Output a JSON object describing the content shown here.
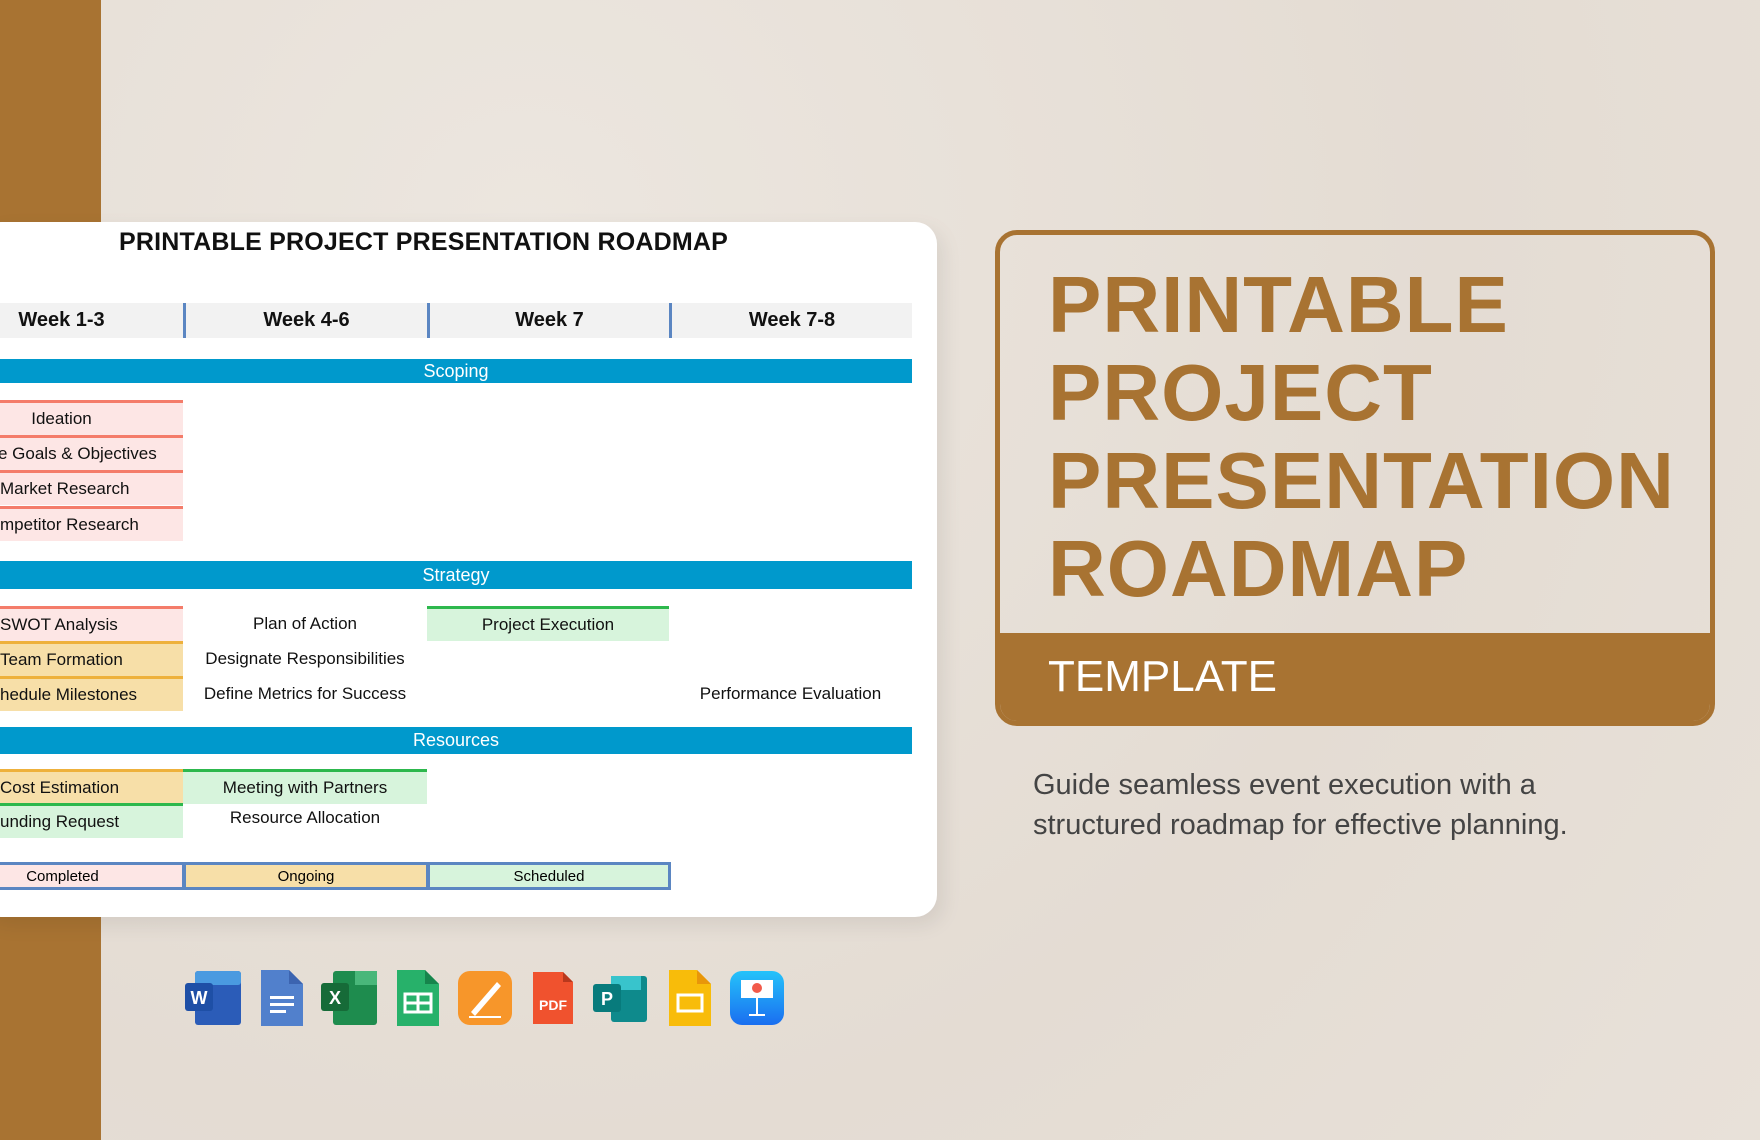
{
  "card": {
    "title": "PRINTABLE PROJECT PRESENTATION ROADMAP",
    "weeks": [
      "Week 1-3",
      "Week 4-6",
      "Week 7",
      "Week 7-8"
    ],
    "sections": {
      "scoping": "Scoping",
      "strategy": "Strategy",
      "resources": "Resources"
    },
    "scoping_items": [
      "Ideation",
      "e Goals & Objectives",
      "Market Research",
      "mpetitor Research"
    ],
    "strategy": {
      "swot": "SWOT Analysis",
      "plan": "Plan of Action",
      "execution": "Project Execution",
      "team": "Team Formation",
      "designate": "Designate Responsibilities",
      "milestones": "hedule Milestones",
      "metrics": "Define Metrics for Success",
      "evaluation": "Performance Evaluation"
    },
    "resources": {
      "cost": "Cost Estimation",
      "meeting": "Meeting with Partners",
      "funding": "unding Request",
      "allocation": "Resource Allocation"
    },
    "legend": [
      "Completed",
      "Ongoing",
      "Scheduled"
    ],
    "colors": {
      "completed": "#fde6e5",
      "ongoing": "#f7dfa8",
      "scheduled": "#d7f4dc",
      "section": "#0099cc"
    }
  },
  "hero": {
    "title_lines": [
      "PRINTABLE",
      "PROJECT",
      "PRESENTATION",
      "ROADMAP"
    ],
    "subtitle": "TEMPLATE",
    "description": "Guide seamless event execution with a structured roadmap for effective planning.",
    "accent": "#a87332"
  },
  "formats": [
    "word-icon",
    "google-docs-icon",
    "excel-icon",
    "google-sheets-icon",
    "pages-icon",
    "pdf-icon",
    "publisher-icon",
    "google-slides-icon",
    "keynote-icon"
  ]
}
